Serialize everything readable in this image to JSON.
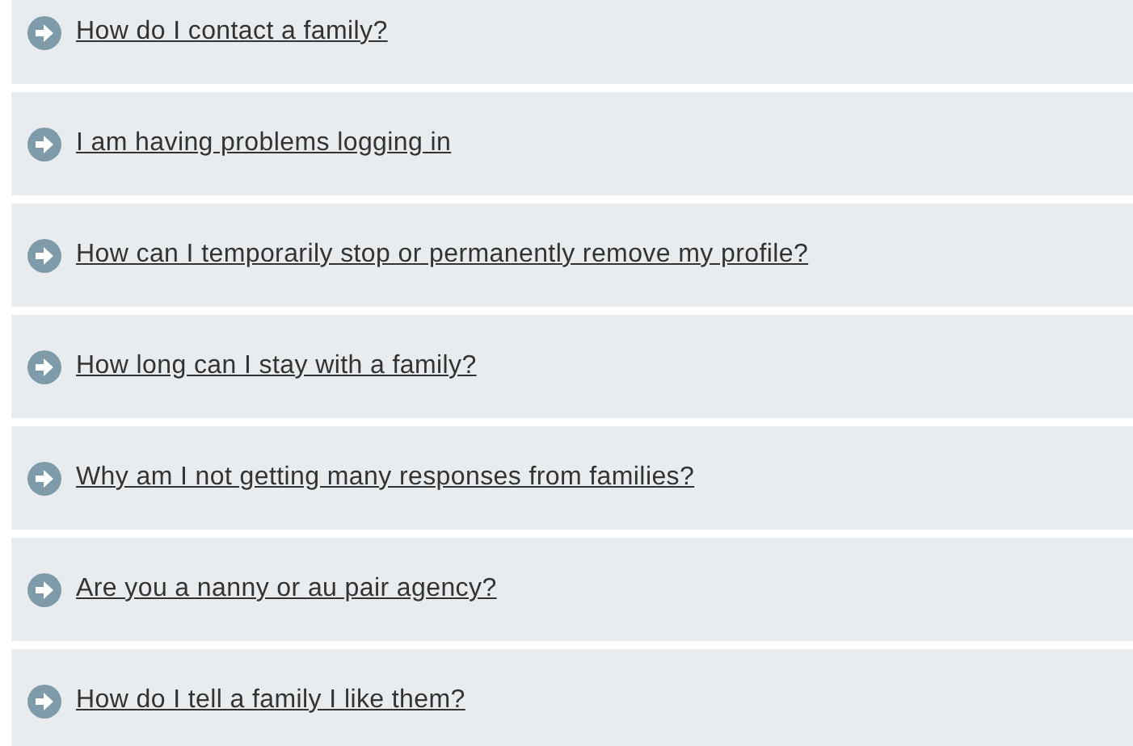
{
  "faq_items": [
    {
      "question": "How do I contact a family?"
    },
    {
      "question": "I am having problems logging in"
    },
    {
      "question": "How can I temporarily stop or permanently remove my profile?"
    },
    {
      "question": "How long can I stay with a family?"
    },
    {
      "question": "Why am I not getting many responses from families?"
    },
    {
      "question": "Are you a nanny or au pair agency?"
    },
    {
      "question": "How do I tell a family I like them?"
    }
  ]
}
